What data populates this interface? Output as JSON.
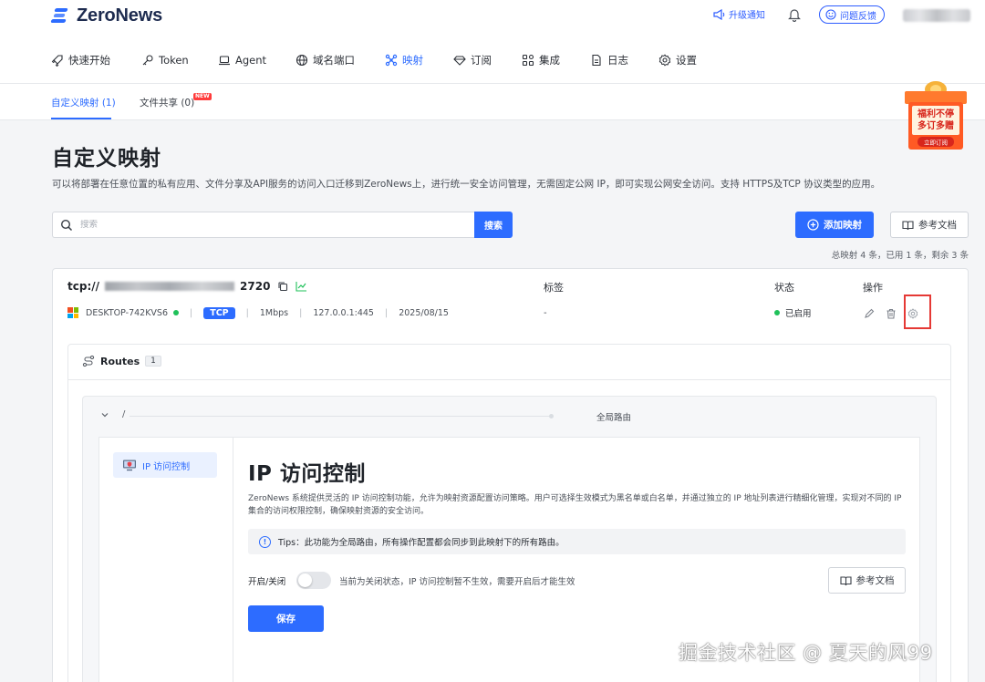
{
  "brand": {
    "name": "ZeroNews"
  },
  "header": {
    "upgrade_label": "升级通知",
    "feedback_label": "问题反馈"
  },
  "nav": {
    "items": [
      {
        "label": "快速开始",
        "icon": "rocket-icon"
      },
      {
        "label": "Token",
        "icon": "key-icon"
      },
      {
        "label": "Agent",
        "icon": "laptop-icon"
      },
      {
        "label": "域名端口",
        "icon": "globe-icon"
      },
      {
        "label": "映射",
        "icon": "mapping-icon",
        "active": true
      },
      {
        "label": "订阅",
        "icon": "diamond-icon"
      },
      {
        "label": "集成",
        "icon": "apps-icon"
      },
      {
        "label": "日志",
        "icon": "document-icon"
      },
      {
        "label": "设置",
        "icon": "gear-icon"
      }
    ]
  },
  "subtabs": {
    "custom": "自定义映射 (1)",
    "files": "文件共享 (0)",
    "new_badge": "NEW"
  },
  "promo": {
    "line1": "福利不停",
    "line2": "多订多赠",
    "cta": "立即订阅"
  },
  "page": {
    "title": "自定义映射",
    "description": "可以将部署在任意位置的私有应用、文件分享及API服务的访问入口迁移到ZeroNews上，进行统一安全访问管理，无需固定公网 IP，即可实现公网安全访问。支持 HTTPS及TCP 协议类型的应用。"
  },
  "search": {
    "placeholder": "搜索",
    "button_label": "搜索"
  },
  "actions": {
    "add_label": "添加映射",
    "docs_label": "参考文档"
  },
  "summary": "总映射 4 条，已用 1 条，剩余 3 条",
  "mapping": {
    "url_prefix": "tcp://",
    "url_suffix": "2720",
    "columns": {
      "tags": "标签",
      "status": "状态",
      "ops": "操作"
    },
    "agent": "DESKTOP-742KVS6",
    "protocol": "TCP",
    "bandwidth": "1Mbps",
    "target": "127.0.0.1:445",
    "date": "2025/08/15",
    "tag_value": "-",
    "status": "已启用"
  },
  "routes": {
    "title": "Routes",
    "count": "1",
    "path": "/",
    "scope": "全局路由"
  },
  "ip_control": {
    "side_label": "IP 访问控制",
    "title": "IP 访问控制",
    "description": "ZeroNews 系统提供灵活的 IP 访问控制功能，允许为映射资源配置访问策略。用户可选择生效模式为黑名单或白名单，并通过独立的 IP 地址列表进行精细化管理，实现对不同的 IP 集合的访问权限控制，确保映射资源的安全访问。",
    "tips": "Tips：此功能为全局路由，所有操作配置都会同步到此映射下的所有路由。",
    "toggle_label": "开启/关闭",
    "toggle_hint": "当前为关闭状态，IP 访问控制暂不生效，需要开启后才能生效",
    "toggle_on": false,
    "docs_label": "参考文档",
    "save_label": "保存"
  },
  "watermark": "掘金技术社区 @ 夏天的风99",
  "colors": {
    "accent": "#2d6cff",
    "success": "#1fc15a",
    "highlight": "#e53935"
  }
}
